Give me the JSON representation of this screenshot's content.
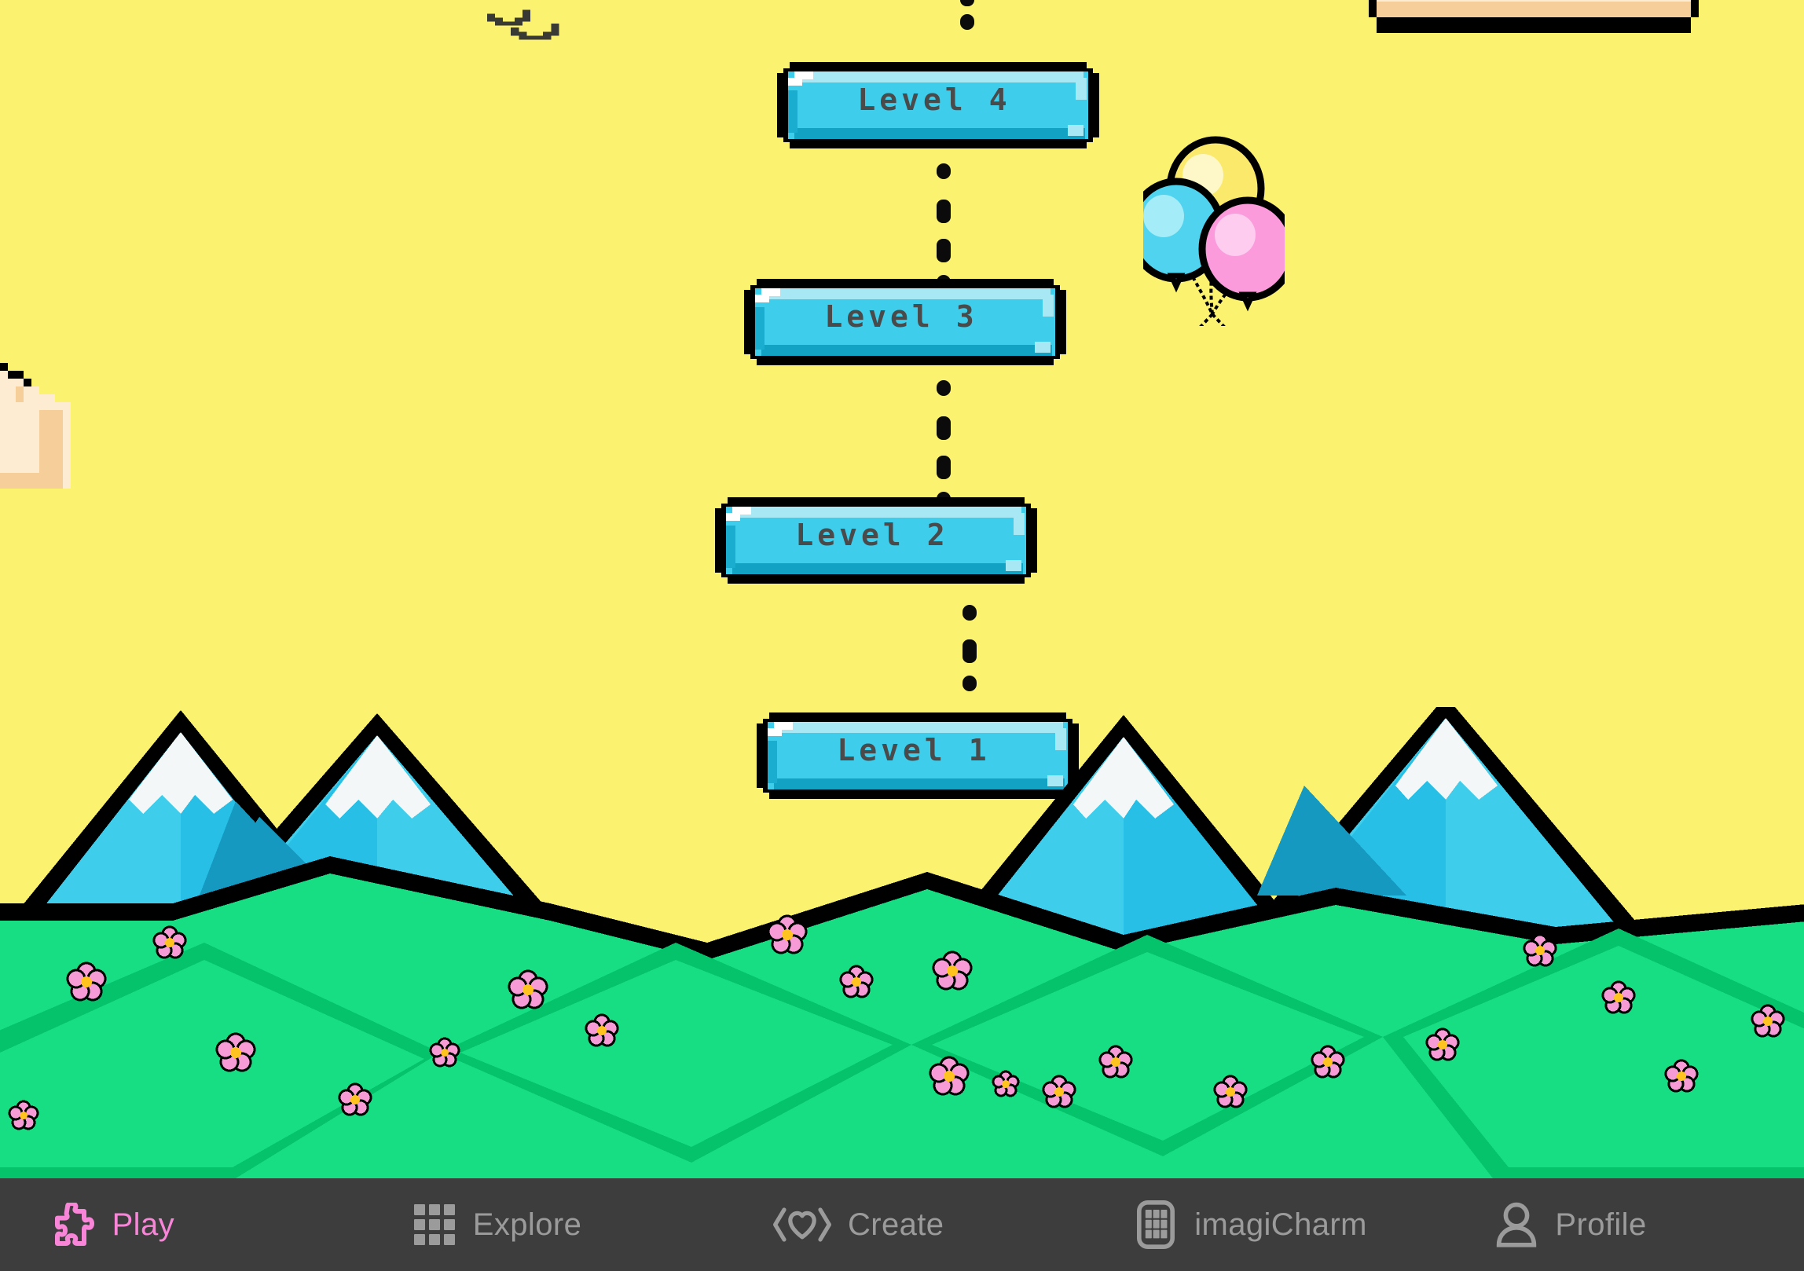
{
  "app": {
    "screen_name": "Play",
    "background_color": "#FBF26F"
  },
  "level_map": {
    "title_visible": false,
    "levels": [
      {
        "label": "Level 4",
        "number": 4,
        "state": "unlocked"
      },
      {
        "label": "Level 3",
        "number": 3,
        "state": "unlocked"
      },
      {
        "label": "Level 2",
        "number": 2,
        "state": "unlocked"
      },
      {
        "label": "Level 1",
        "number": 1,
        "state": "unlocked"
      }
    ],
    "button_colors": {
      "face": "#3FCDEC",
      "top_highlight": "#A8E8F5",
      "bottom_shadow": "#12A3C4",
      "outline": "#000000",
      "label_text": "#4A4A4A"
    },
    "trail_dot_color": "#0B0B0B"
  },
  "decor": {
    "balloons": [
      {
        "name": "yellow-balloon",
        "color": "#FBE96B"
      },
      {
        "name": "cyan-balloon",
        "color": "#4FD3EE"
      },
      {
        "name": "pink-balloon",
        "color": "#FB9BDC"
      }
    ],
    "clouds": [
      {
        "name": "cloud-left",
        "fill": "#FDEBD2",
        "shadow": "#F6CE9A"
      },
      {
        "name": "cloud-top-right",
        "fill": "#FDEBD2",
        "shadow": "#F6CE9A"
      }
    ],
    "birds": [
      {
        "name": "bird-1"
      },
      {
        "name": "bird-2"
      }
    ],
    "terrain_colors": {
      "snow": "#F4F7F8",
      "mountain_shadow": "#1699C0",
      "mountain_light": "#3FCDEC",
      "mountain_mid": "#27BFE6",
      "hill_light": "#17DE82",
      "hill_dark": "#04C36A",
      "flower_petal": "#F79BD6",
      "flower_center": "#FFC31F",
      "outline": "#000000"
    }
  },
  "bottom_nav": {
    "background": "#3D3D3D",
    "active_color": "#F985D9",
    "inactive_color": "#9B9B9B",
    "items": [
      {
        "label": "Play",
        "icon": "puzzle-piece-icon",
        "active": true
      },
      {
        "label": "Explore",
        "icon": "grid-3x3-icon",
        "active": false
      },
      {
        "label": "Create",
        "icon": "code-heart-icon",
        "active": false
      },
      {
        "label": "imagiCharm",
        "icon": "charm-device-icon",
        "active": false
      },
      {
        "label": "Profile",
        "icon": "person-icon",
        "active": false
      }
    ]
  }
}
